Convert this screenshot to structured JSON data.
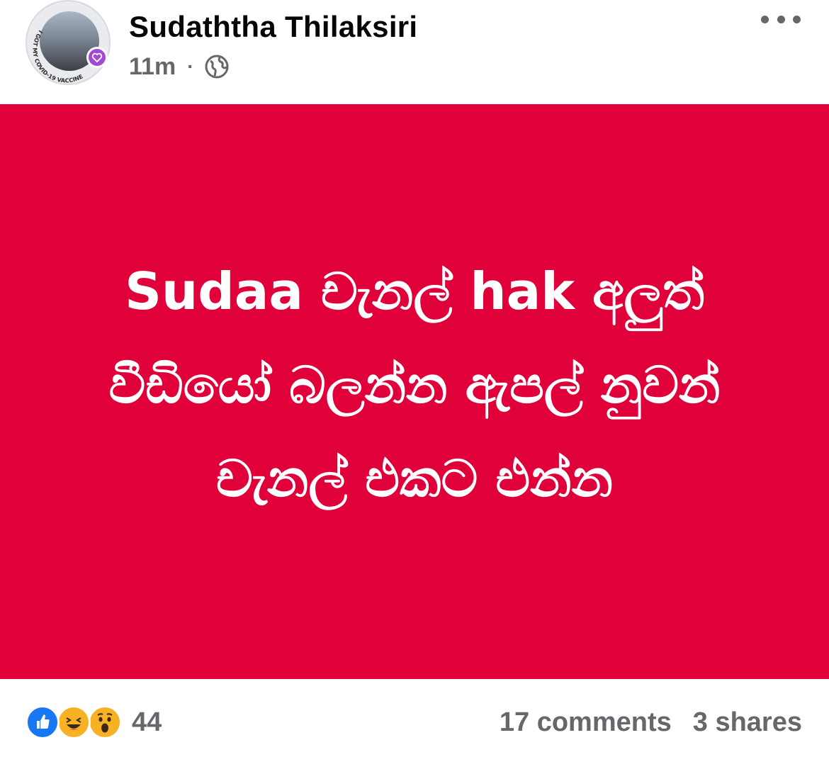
{
  "post": {
    "author_name": "Sudaththa Thilaksiri",
    "time_ago": "11m",
    "separator": "·",
    "privacy_icon": "globe-icon",
    "avatar_frame_text": "I GOT MY COVID-19 VACCINE",
    "more_icon": "more-horizontal-icon",
    "background_color": "#e0003a",
    "text_lines": [
      "Sudaa චැනල් hak අලුත්",
      "වීඩියෝ බලන්න ඇපල් නුවන්",
      "චැනල් එකට එන්න"
    ]
  },
  "footer": {
    "reactions": [
      "like-icon",
      "haha-icon",
      "wow-icon"
    ],
    "reaction_count": "44",
    "comments": "17 comments",
    "shares": "3 shares"
  }
}
